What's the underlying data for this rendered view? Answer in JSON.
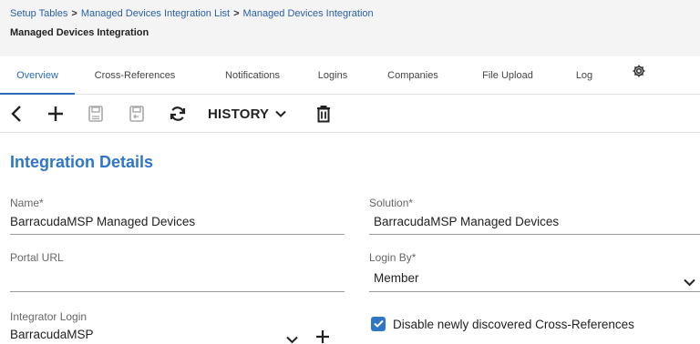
{
  "breadcrumb": {
    "items": [
      "Setup Tables",
      "Managed Devices Integration List",
      "Managed Devices Integration"
    ],
    "separator": ">"
  },
  "page_title": "Managed Devices Integration",
  "tabs": {
    "active": "Overview",
    "items": [
      "Overview",
      "Cross-References",
      "Notifications",
      "Logins",
      "Companies",
      "File Upload",
      "Log"
    ],
    "settings_icon": "gear-icon"
  },
  "toolbar": {
    "history_label": "HISTORY",
    "icons": [
      "back-icon",
      "add-icon",
      "save-icon",
      "save-and-close-icon",
      "refresh-icon",
      "chevron-down-icon",
      "trash-icon"
    ]
  },
  "section": {
    "title": "Integration Details"
  },
  "fields": {
    "name": {
      "label": "Name*",
      "value": "BarracudaMSP Managed Devices"
    },
    "solution": {
      "label": "Solution*",
      "value": "BarracudaMSP Managed Devices"
    },
    "portal_url": {
      "label": "Portal URL",
      "value": ""
    },
    "login_by": {
      "label": "Login By*",
      "value": "Member"
    },
    "integrator_login": {
      "label": "Integrator Login",
      "value": "BarracudaMSP"
    },
    "disable_xrefs": {
      "label": "Disable newly discovered Cross-References",
      "checked": true
    }
  },
  "colors": {
    "accent": "#2f76c8",
    "link": "#2a5fa6",
    "header_bg": "#f4f4f4"
  }
}
